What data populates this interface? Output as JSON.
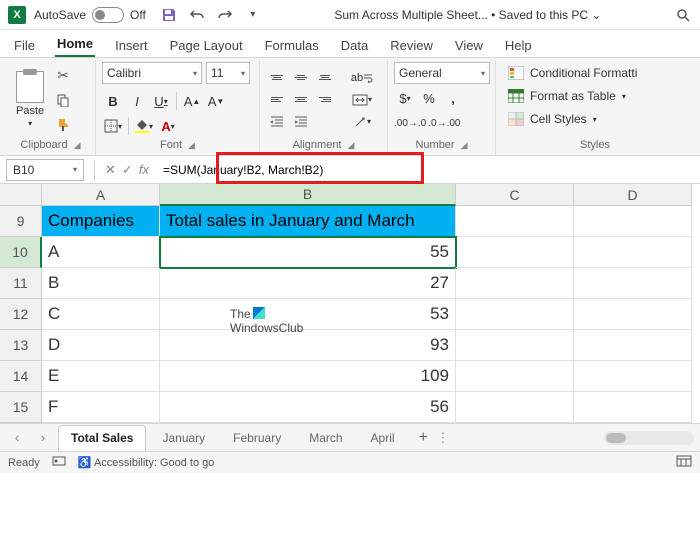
{
  "titlebar": {
    "autosave_label": "AutoSave",
    "autosave_state": "Off",
    "doc_title": "Sum Across Multiple Sheet...",
    "save_status": "Saved to this PC",
    "chevron": "⌄"
  },
  "tabs": {
    "file": "File",
    "home": "Home",
    "insert": "Insert",
    "page_layout": "Page Layout",
    "formulas": "Formulas",
    "data": "Data",
    "review": "Review",
    "view": "View",
    "help": "Help"
  },
  "ribbon": {
    "clipboard": {
      "paste": "Paste",
      "label": "Clipboard"
    },
    "font": {
      "name": "Calibri",
      "size": "11",
      "label": "Font"
    },
    "alignment": {
      "label": "Alignment",
      "wrap": "ab"
    },
    "number": {
      "format": "General",
      "label": "Number"
    },
    "styles": {
      "conditional": "Conditional Formatti",
      "table": "Format as Table",
      "cell": "Cell Styles",
      "label": "Styles"
    }
  },
  "formula_bar": {
    "cell_ref": "B10",
    "formula": "=SUM(January!B2, March!B2)"
  },
  "columns": {
    "a": "A",
    "b": "B",
    "c": "C",
    "d": "D"
  },
  "rows": {
    "h": {
      "num": "9",
      "a": "Companies",
      "b": "Total sales in January and March"
    },
    "r10": {
      "num": "10",
      "a": "A",
      "b": "55"
    },
    "r11": {
      "num": "11",
      "a": "B",
      "b": "27"
    },
    "r12": {
      "num": "12",
      "a": "C",
      "b": "53"
    },
    "r13": {
      "num": "13",
      "a": "D",
      "b": "93"
    },
    "r14": {
      "num": "14",
      "a": "E",
      "b": "109"
    },
    "r15": {
      "num": "15",
      "a": "F",
      "b": "56"
    }
  },
  "watermark": {
    "line1": "The",
    "line2": "WindowsClub"
  },
  "sheets": {
    "total": "Total Sales",
    "jan": "January",
    "feb": "February",
    "mar": "March",
    "apr": "April"
  },
  "status": {
    "ready": "Ready",
    "accessibility": "Accessibility: Good to go"
  },
  "chart_data": {
    "type": "table",
    "title": "Total sales in January and March",
    "columns": [
      "Companies",
      "Total sales in January and March"
    ],
    "rows": [
      {
        "company": "A",
        "total": 55
      },
      {
        "company": "B",
        "total": 27
      },
      {
        "company": "C",
        "total": 53
      },
      {
        "company": "D",
        "total": 93
      },
      {
        "company": "E",
        "total": 109
      },
      {
        "company": "F",
        "total": 56
      }
    ]
  }
}
